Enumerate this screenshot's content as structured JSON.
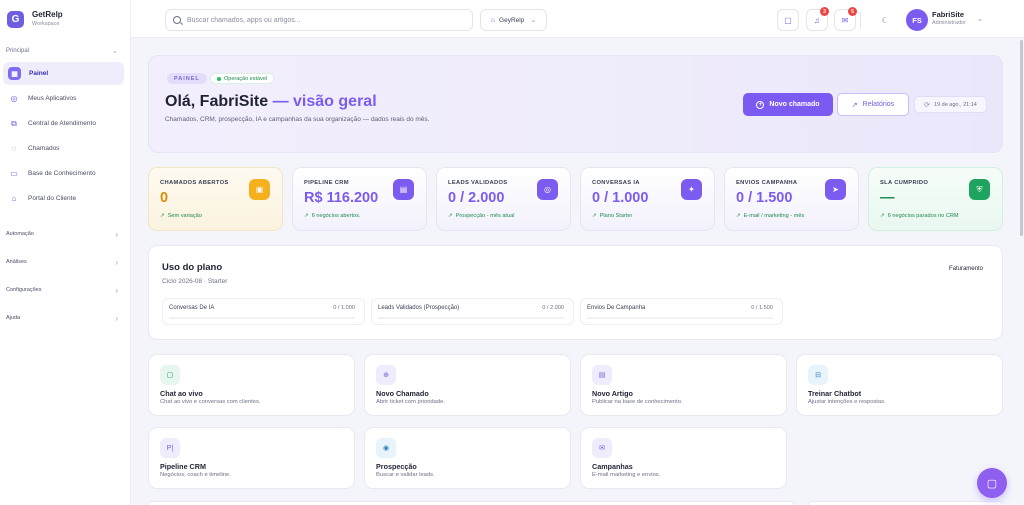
{
  "brand": {
    "name": "GetRelp",
    "subtitle": "Workspace",
    "logo_letter": "G"
  },
  "sidebar": {
    "section_label": "Principal",
    "items": [
      {
        "label": "Painel",
        "icon": "dashboard-icon",
        "active": true
      },
      {
        "label": "Meus Aplicativos",
        "icon": "apps-icon"
      },
      {
        "label": "Central de Atendimento",
        "icon": "support-icon"
      },
      {
        "label": "Chamados",
        "icon": "ticket-icon"
      },
      {
        "label": "Base de Conhecimento",
        "icon": "book-icon"
      },
      {
        "label": "Portal do Cliente",
        "icon": "home-icon"
      }
    ],
    "groups": [
      {
        "label": "Automação"
      },
      {
        "label": "Análises"
      },
      {
        "label": "Configurações"
      },
      {
        "label": "Ajuda"
      }
    ]
  },
  "topbar": {
    "search_placeholder": "Buscar chamados, apps ou artigos...",
    "workspace": "GeyRelp",
    "notifications_count": "3",
    "messages_count": "5",
    "user": {
      "initials": "FS",
      "name": "FabriSite",
      "role": "Administrador"
    }
  },
  "hero": {
    "tag": "PAINEL",
    "status": "Operação estável",
    "title_main": "Olá, FabriSite",
    "title_accent": " — visão geral",
    "description": "Chamados, CRM, prospecção, IA e campanhas da sua organização — dados reais do mês.",
    "primary_button": "Novo chamado",
    "secondary_button": "Relatórios",
    "updated": "19 de ago., 21:14"
  },
  "kpis": [
    {
      "label": "CHAMADOS ABERTOS",
      "value": "0",
      "foot": "Sem variação",
      "variant": "warn",
      "icon": "ticket-icon"
    },
    {
      "label": "PIPELINE CRM",
      "value": "R$ 116.200",
      "foot": "6 negócios abertos.",
      "variant": "default",
      "icon": "briefcase-icon"
    },
    {
      "label": "LEADS VALIDADOS",
      "value": "0 / 2.000",
      "foot": "Prospecção - mês atual",
      "variant": "default",
      "icon": "target-icon"
    },
    {
      "label": "CONVERSAS IA",
      "value": "0 / 1.000",
      "foot": "Plano Starter",
      "variant": "default",
      "icon": "ai-icon"
    },
    {
      "label": "ENVIOS CAMPANHA",
      "value": "0 / 1.500",
      "foot": "E-mail / marketing - mês",
      "variant": "default",
      "icon": "send-icon"
    },
    {
      "label": "SLA CUMPRIDO",
      "value": "—",
      "foot": "6 negócios parados no CRM",
      "variant": "ok",
      "icon": "shield-icon"
    }
  ],
  "plan": {
    "title": "Uso do plano",
    "subtitle": "Ciclo 2026-08 · Starter",
    "link": "Faturamento",
    "usage": [
      {
        "label": "Conversas De IA",
        "value": "0 / 1.000",
        "fraction": 0
      },
      {
        "label": "Leads Validados (Prospecção)",
        "value": "0 / 2.000",
        "fraction": 0
      },
      {
        "label": "Envios De Campanha",
        "value": "0 / 1.500",
        "fraction": 0
      }
    ]
  },
  "actions": [
    {
      "title": "Chat ao vivo",
      "desc": "Chat ao vivo e conversas com clientes.",
      "icon": "chat-icon",
      "color": "#e7f6ee",
      "fg": "#1f8b4c"
    },
    {
      "title": "Novo Chamado",
      "desc": "Abrir ticket com prioridade.",
      "icon": "plus-circle-icon",
      "color": "#efecfd",
      "fg": "#6d5fe0"
    },
    {
      "title": "Novo Artigo",
      "desc": "Publicar na base de conhecimento.",
      "icon": "document-icon",
      "color": "#efecfd",
      "fg": "#6d5fe0"
    },
    {
      "title": "Treinar Chatbot",
      "desc": "Ajustar intenções e respostas.",
      "icon": "robot-icon",
      "color": "#e8f4fb",
      "fg": "#2d7fb8"
    },
    {
      "title": "Pipeline CRM",
      "desc": "Negócios, coach e timeline.",
      "icon": "pipeline-icon",
      "color": "#efecfd",
      "fg": "#6d5fe0"
    },
    {
      "title": "Prospecção",
      "desc": "Buscar e validar leads.",
      "icon": "compass-icon",
      "color": "#e8f4fb",
      "fg": "#2d7fb8"
    },
    {
      "title": "Campanhas",
      "desc": "E-mail marketing e envios.",
      "icon": "mail-icon",
      "color": "#efecfd",
      "fg": "#6d5fe0"
    }
  ],
  "colors": {
    "accent": "#7c5cf0",
    "success": "#1f8b4c",
    "warning": "#f5b01e",
    "danger": "#ef4444"
  }
}
